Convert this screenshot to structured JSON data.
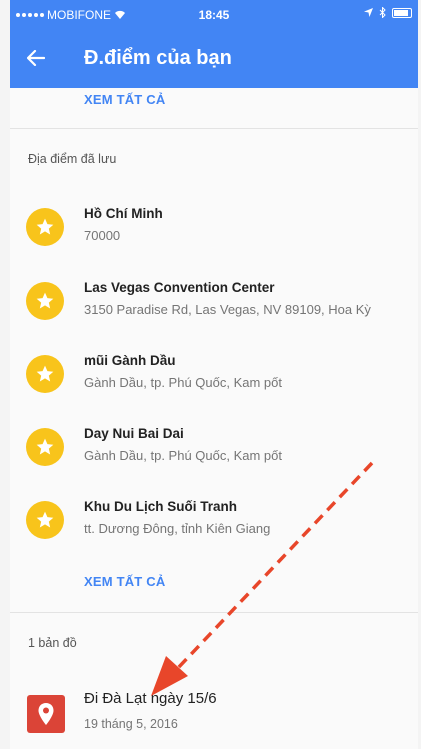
{
  "status": {
    "carrier": "MOBIFONE",
    "time": "18:45"
  },
  "appbar": {
    "title": "Đ.điểm của bạn"
  },
  "top_link": "XEM TẤT CẢ",
  "saved": {
    "label": "Địa điểm đã lưu",
    "items": [
      {
        "title": "Hồ Chí Minh",
        "subtitle": "70000"
      },
      {
        "title": "Las Vegas Convention Center",
        "subtitle": "3150 Paradise Rd, Las Vegas, NV 89109, Hoa Kỳ"
      },
      {
        "title": "mũi Gành Dầu",
        "subtitle": "Gành Dầu, tp. Phú Quốc, Kam pốt"
      },
      {
        "title": "Day Nui Bai Dai",
        "subtitle": "Gành Dầu, tp. Phú Quốc, Kam pốt"
      },
      {
        "title": "Khu Du Lịch Suối Tranh",
        "subtitle": "tt. Dương Đông, tỉnh Kiên Giang"
      }
    ],
    "see_all": "XEM TẤT CẢ"
  },
  "maps": {
    "label": "1 bản đồ",
    "item": {
      "title": "Đi Đà Lạt ngày 15/6",
      "subtitle": "19 tháng 5, 2016"
    }
  },
  "colors": {
    "primary": "#4285f4",
    "star": "#f8c41b",
    "map": "#db4437",
    "arrow": "#e8462a"
  }
}
